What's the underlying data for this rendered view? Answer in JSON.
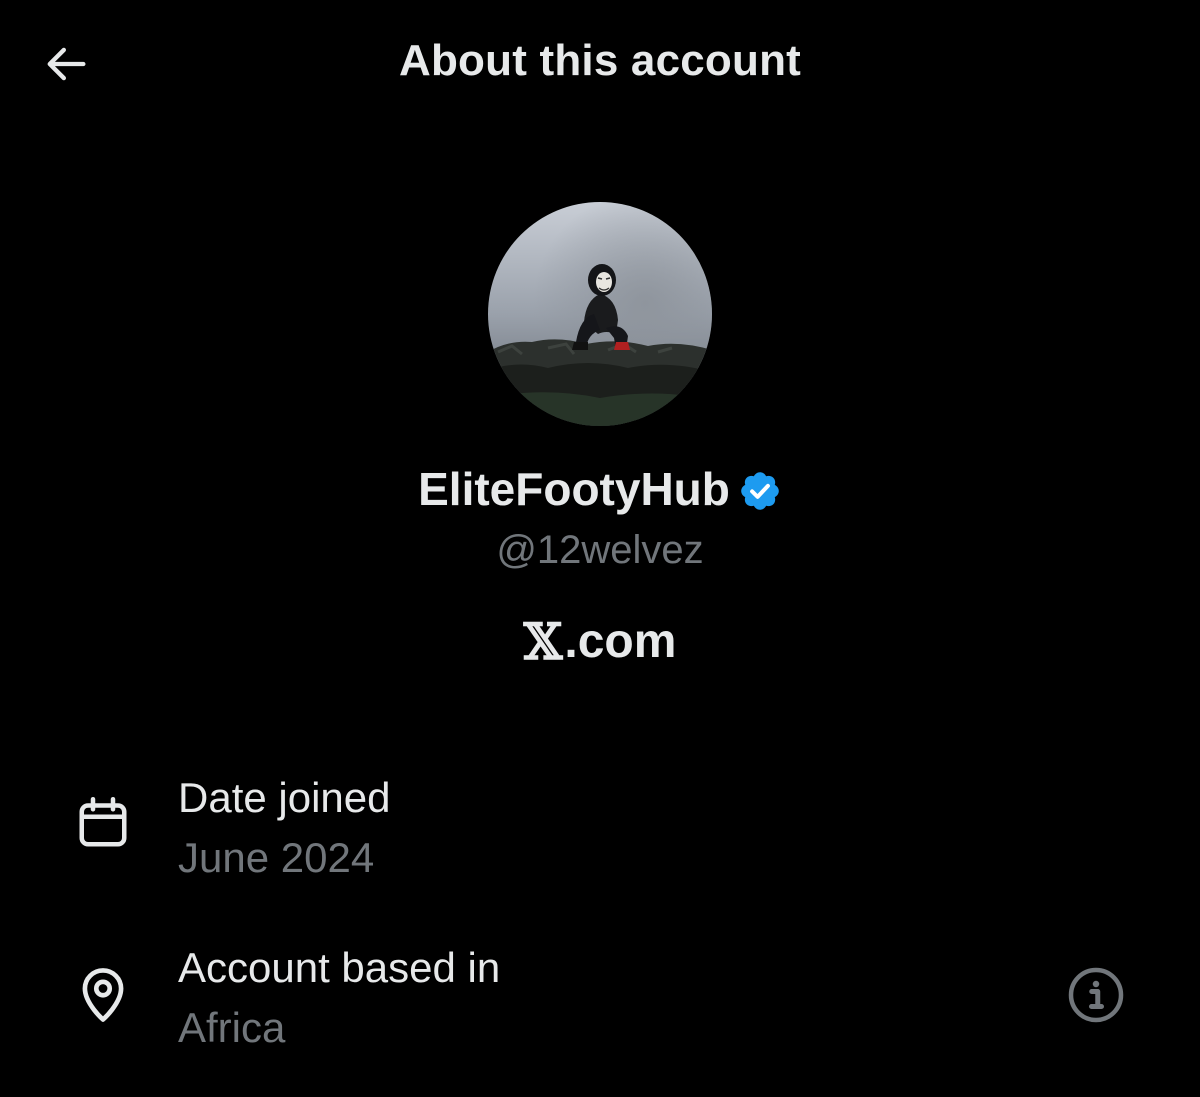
{
  "header": {
    "title": "About this account",
    "back_icon": "arrow-left-icon"
  },
  "profile": {
    "display_name": "EliteFootyHub",
    "verified_icon": "verified-badge-icon",
    "verified_color": "#1d9bf0",
    "handle": "@12welvez",
    "platform_x": "𝕏",
    "platform_suffix": ".com"
  },
  "details": {
    "date_joined": {
      "icon": "calendar-icon",
      "label": "Date joined",
      "value": "June 2024"
    },
    "account_based_in": {
      "icon": "location-pin-icon",
      "label": "Account based in",
      "value": "Africa",
      "info_icon": "info-icon"
    }
  },
  "colors": {
    "background": "#000000",
    "primary_text": "#e7e9ea",
    "secondary_text": "#71767b",
    "accent": "#1d9bf0"
  }
}
